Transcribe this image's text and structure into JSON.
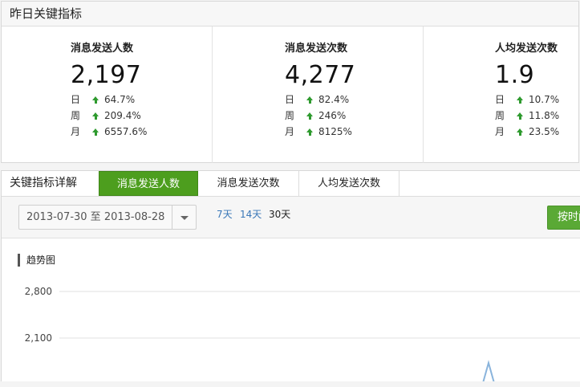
{
  "kpi": {
    "header": "昨日关键指标",
    "items": [
      {
        "title": "消息发送人数",
        "value": "2,197",
        "changes": [
          {
            "label": "日",
            "value": "64.7%"
          },
          {
            "label": "周",
            "value": "209.4%"
          },
          {
            "label": "月",
            "value": "6557.6%"
          }
        ]
      },
      {
        "title": "消息发送次数",
        "value": "4,277",
        "changes": [
          {
            "label": "日",
            "value": "82.4%"
          },
          {
            "label": "周",
            "value": "246%"
          },
          {
            "label": "月",
            "value": "8125%"
          }
        ]
      },
      {
        "title": "人均发送次数",
        "value": "1.9",
        "changes": [
          {
            "label": "日",
            "value": "10.7%"
          },
          {
            "label": "周",
            "value": "11.8%"
          },
          {
            "label": "月",
            "value": "23.5%"
          }
        ]
      }
    ],
    "trend_direction": "up",
    "up_color": "#2e9a2e"
  },
  "details": {
    "title": "关键指标详解",
    "tabs": [
      {
        "label": "消息发送人数",
        "active": true
      },
      {
        "label": "消息发送次数",
        "active": false
      },
      {
        "label": "人均发送次数",
        "active": false
      }
    ],
    "accent_color": "#4d9e1e",
    "date_range": "2013-07-30 至 2013-08-28",
    "ranges": [
      {
        "label": "7天"
      },
      {
        "label": "14天"
      },
      {
        "label": "30天",
        "selected": true
      }
    ],
    "export_label": "按时间"
  },
  "chart_data": {
    "type": "line",
    "title": "趋势图",
    "yticks": [
      2800,
      2100
    ],
    "ytick_labels": [
      "2,800",
      "2,100"
    ],
    "grid": true,
    "line_color": "#8ab4dc"
  }
}
